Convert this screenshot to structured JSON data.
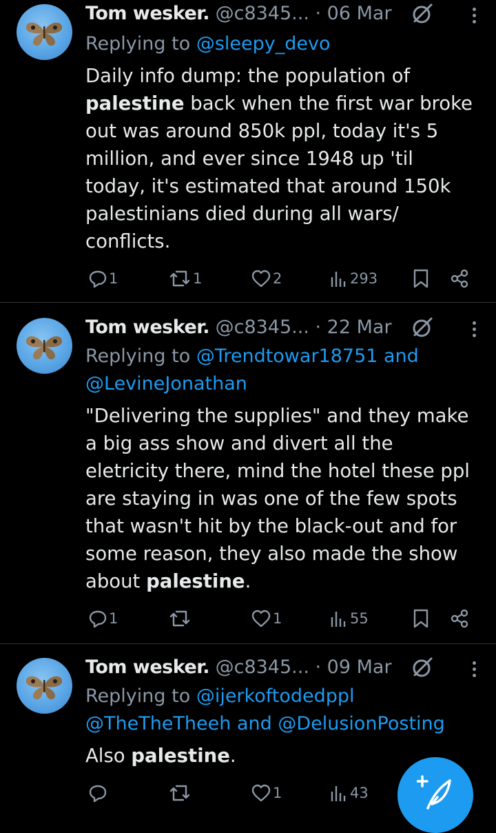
{
  "tweets": [
    {
      "name": "Tom wesker.",
      "handle": "@c8345...",
      "date": "· 06 Mar",
      "reply_prefix": "Replying to ",
      "reply_handles": [
        "@sleepy_devo"
      ],
      "body_segments": [
        {
          "text": "Daily info dump: the population of ",
          "bold": false
        },
        {
          "text": "palestine",
          "bold": true
        },
        {
          "text": " back when the first war broke out was around 850k ppl, today it's 5 million, and ever since 1948 up 'til today, it's estimated that around 150k palestinians died during all wars/ conflicts.",
          "bold": false
        }
      ],
      "replies": "1",
      "retweets": "1",
      "likes": "2",
      "views": "293"
    },
    {
      "name": "Tom wesker.",
      "handle": "@c8345...",
      "date": "· 22 Mar",
      "reply_prefix": "Replying to ",
      "reply_line1": "@Trendtowar18751 and",
      "reply_line2": "@LevineJonathan",
      "body_segments": [
        {
          "text": "\"Delivering the supplies\" and they make a big ass show and divert all the eletricity there, mind the hotel these ppl are staying in was one of the few spots that wasn't hit by the black-out and for some reason, they also made the show about ",
          "bold": false
        },
        {
          "text": "palestine",
          "bold": true
        },
        {
          "text": ".",
          "bold": false
        }
      ],
      "replies": "1",
      "retweets": "",
      "likes": "1",
      "views": "55"
    },
    {
      "name": "Tom wesker.",
      "handle": "@c8345...",
      "date": "· 09 Mar",
      "reply_prefix": "Replying to ",
      "reply_line1": "@ijerkoftodedppl",
      "reply_line2": "@TheTheTheeh and @DelusionPosting",
      "body_segments": [
        {
          "text": "Also ",
          "bold": false
        },
        {
          "text": "palestine",
          "bold": true
        },
        {
          "text": ".",
          "bold": false
        }
      ],
      "replies": "",
      "retweets": "",
      "likes": "1",
      "views": "43"
    }
  ],
  "colors": {
    "background": "#000000",
    "text": "#e7e9ea",
    "muted": "#8b98a5",
    "accent": "#1d9bf0",
    "divider": "#2f3336"
  },
  "icons": {
    "verified": "circle-slash-icon",
    "more": "vertical-ellipsis-icon",
    "reply": "speech-bubble-icon",
    "retweet": "retweet-icon",
    "like": "heart-icon",
    "views": "bar-chart-icon",
    "bookmark": "bookmark-icon",
    "share": "share-icon",
    "compose": "feather-plus-icon"
  }
}
